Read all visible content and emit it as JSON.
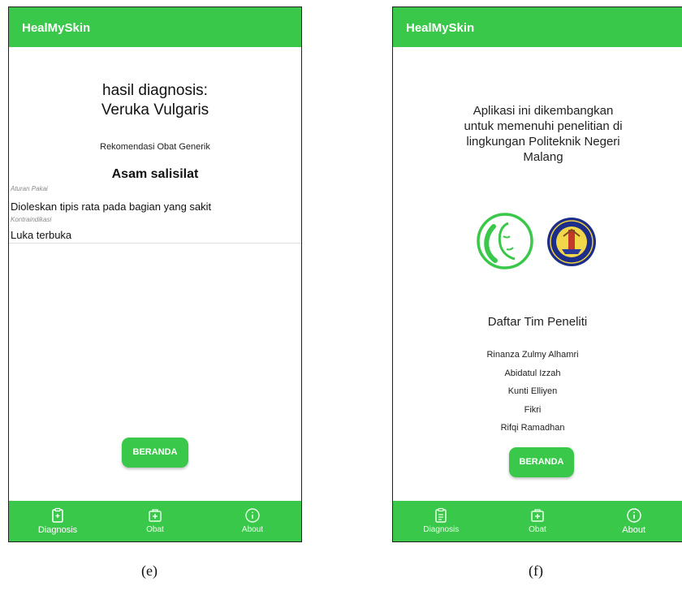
{
  "colors": {
    "primary": "#39c84a",
    "text": "#111111",
    "label_gray": "#888888"
  },
  "screen_e": {
    "app_title": "HealMySkin",
    "result_heading": "hasil diagnosis:",
    "result_name": "Veruka Vulgaris",
    "recommendation_title": "Rekomendasi Obat Generik",
    "medicine_name": "Asam salisilat",
    "usage_label": "Aturan Pakai",
    "usage_value": "Dioleskan tipis rata pada bagian yang sakit",
    "contra_label": "Kontraindikasi",
    "contra_value": "Luka terbuka",
    "home_button": "BERANDA",
    "nav": [
      {
        "label": "Diagnosis",
        "icon": "clipboard-icon"
      },
      {
        "label": "Obat",
        "icon": "medicine-box-icon"
      },
      {
        "label": "About",
        "icon": "info-icon"
      }
    ]
  },
  "screen_f": {
    "app_title": "HealMySkin",
    "description_lines": [
      "Aplikasi ini dikembangkan",
      "untuk memenuhi penelitian di",
      "lingkungan Politeknik Negeri",
      "Malang"
    ],
    "team_title": "Daftar Tim Peneliti",
    "team_members": [
      "Rinanza Zulmy Alhamri",
      "Abidatul Izzah",
      "Kunti Elliyen",
      "Fikri",
      "Rifqi Ramadhan"
    ],
    "home_button": "BERANDA",
    "nav": [
      {
        "label": "Diagnosis",
        "icon": "clipboard-icon"
      },
      {
        "label": "Obat",
        "icon": "medicine-box-icon"
      },
      {
        "label": "About",
        "icon": "info-icon"
      }
    ]
  },
  "captions": [
    "(e)",
    "(f)"
  ]
}
